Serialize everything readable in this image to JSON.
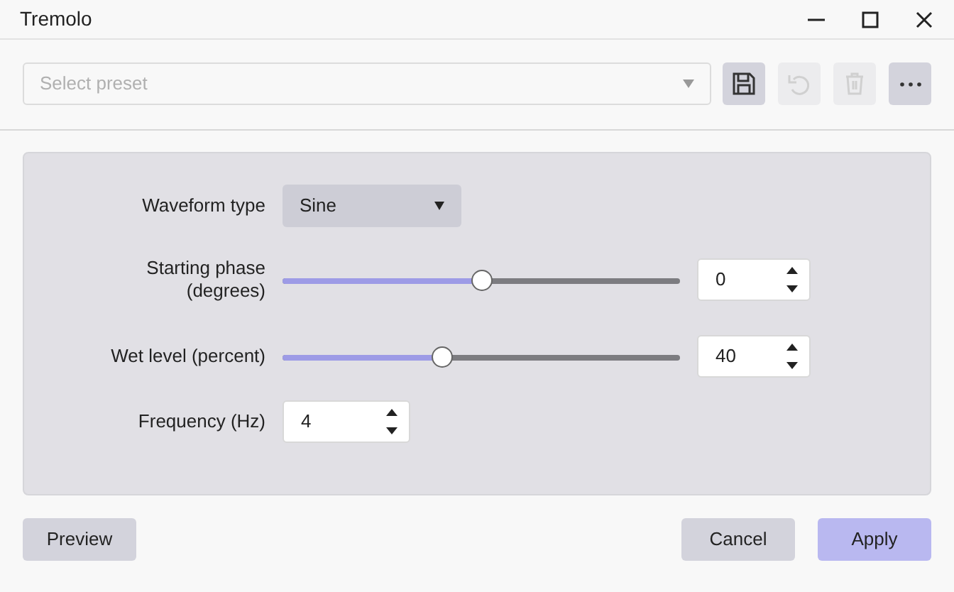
{
  "window": {
    "title": "Tremolo"
  },
  "preset": {
    "placeholder": "Select preset"
  },
  "toolbar": [
    {
      "kind": "save",
      "disabled": false
    },
    {
      "kind": "undo",
      "disabled": true
    },
    {
      "kind": "delete",
      "disabled": true
    },
    {
      "kind": "more",
      "disabled": false
    }
  ],
  "controls": [
    {
      "kind": "dropdown",
      "label": "Waveform type",
      "value": "Sine"
    },
    {
      "kind": "slider",
      "label": "Starting phase\n(degrees)",
      "level": 0.5,
      "value": "0"
    },
    {
      "kind": "slider",
      "label": "Wet level (percent)",
      "level": 0.4,
      "value": "40"
    },
    {
      "kind": "number",
      "label": "Frequency (Hz)",
      "value": "4"
    }
  ],
  "footer": {
    "left": [
      "Preview"
    ],
    "right": [
      {
        "label": "Cancel",
        "primary": false
      },
      {
        "label": "Apply",
        "primary": true
      }
    ]
  }
}
